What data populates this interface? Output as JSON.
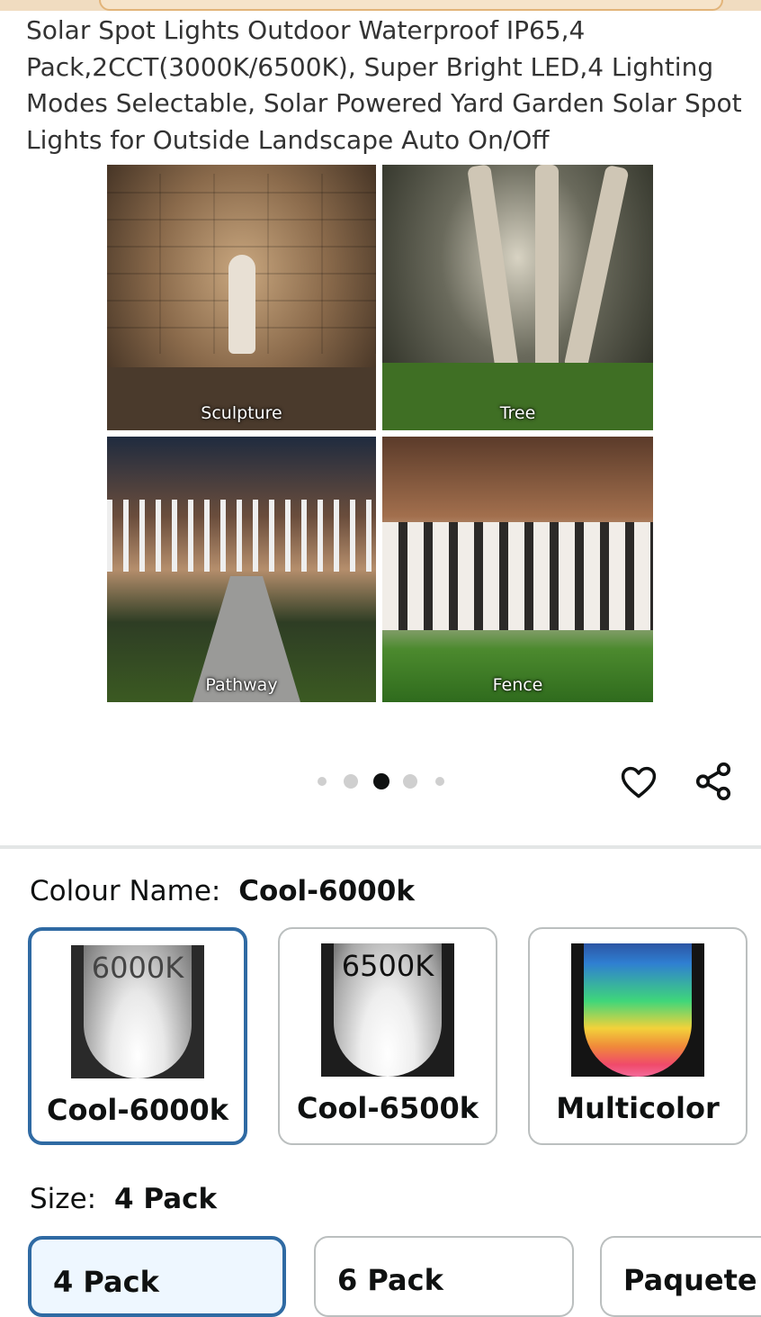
{
  "product": {
    "title": "Solar Spot Lights Outdoor Waterproof IP65,4 Pack,2CCT(3000K/6500K), Super Bright LED,4 Lighting Modes Selectable, Solar Powered Yard Garden Solar Spot Lights for Outside Landscape Auto On/Off"
  },
  "gallery": {
    "captions": [
      "Sculpture",
      "Tree",
      "Pathway",
      "Fence"
    ],
    "dots": {
      "count": 5,
      "active_index": 2
    }
  },
  "actions": {
    "wishlist_icon": "heart-icon",
    "share_icon": "share-icon"
  },
  "colour": {
    "label": "Colour Name:",
    "selected": "Cool-6000k",
    "options": [
      {
        "name": "Cool-6000k",
        "image_text": "6000K",
        "selected": true
      },
      {
        "name": "Cool-6500k",
        "image_text": "6500K",
        "selected": false
      },
      {
        "name": "Multicolor",
        "image_text": "",
        "selected": false
      }
    ]
  },
  "size": {
    "label": "Size:",
    "selected": "4 Pack",
    "options": [
      {
        "name": "4 Pack",
        "selected": true
      },
      {
        "name": "6 Pack",
        "selected": false
      },
      {
        "name": "Paquete",
        "selected": false
      }
    ]
  },
  "colors": {
    "selected_border": "#2f6aa3",
    "dot_active": "#0f1111",
    "dot_inactive": "#cfcfcf"
  }
}
